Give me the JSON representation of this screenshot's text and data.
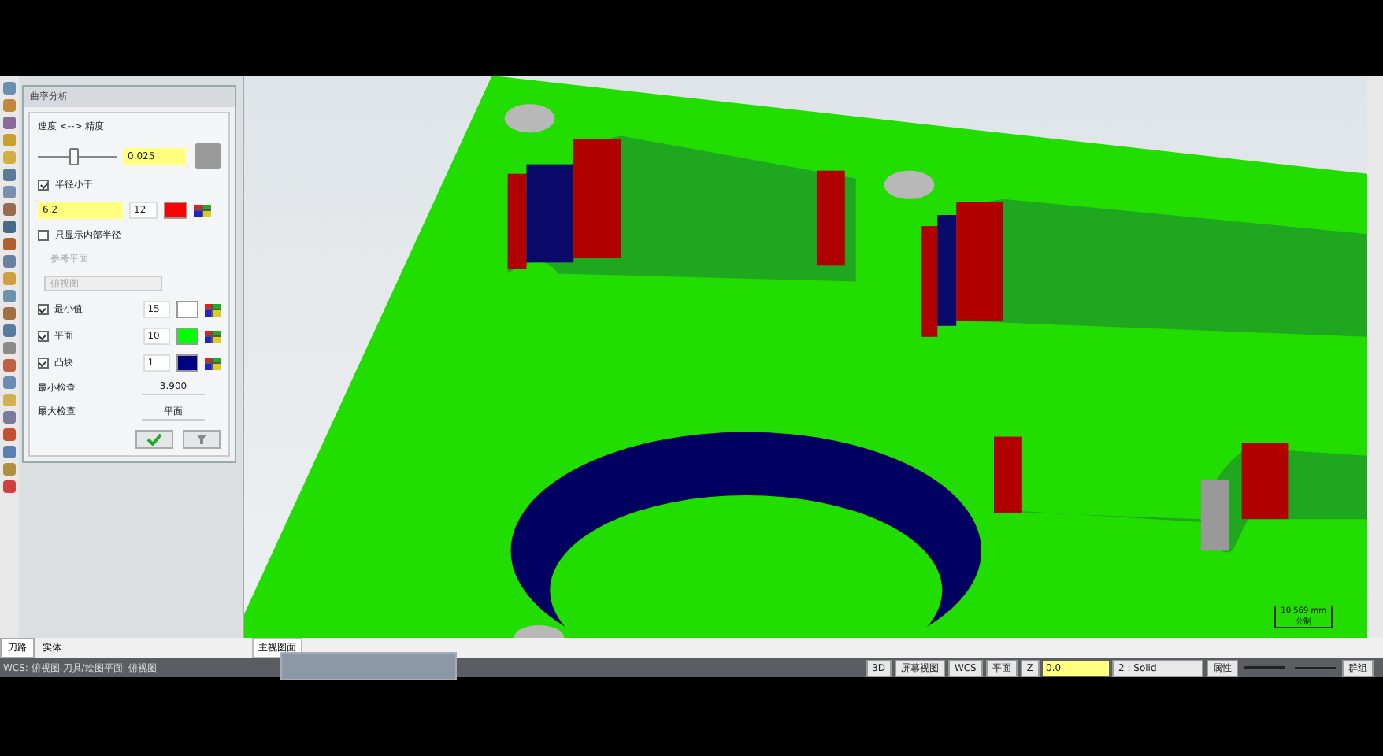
{
  "panel": {
    "title": "曲率分析",
    "slider_label": "速度 <--> 精度",
    "slider": {
      "level": 0.45
    },
    "tolerance": "0.025",
    "radius_option": {
      "label": "半径小于",
      "checked": true,
      "value": "6.2",
      "count": "12",
      "color": "#ff0000"
    },
    "internal_only": {
      "label": "只显示内部半径",
      "checked": false
    },
    "reference_plane": {
      "label": "参考平面",
      "value": "俯视图",
      "disabled": true
    },
    "rows": [
      {
        "label": "最小值",
        "checked": true,
        "count": "15",
        "color": "#ffffff"
      },
      {
        "label": "平面",
        "checked": true,
        "count": "10",
        "color": "#00ff00"
      },
      {
        "label": "凸块",
        "checked": true,
        "count": "1",
        "color": "#000080"
      }
    ],
    "readouts": [
      {
        "label": "最小检查",
        "value": "3.900"
      },
      {
        "label": "最大检查",
        "value": "平面"
      }
    ]
  },
  "manager_tabs": [
    {
      "label": "刀路",
      "selected": true
    },
    {
      "label": "实体",
      "selected": false
    }
  ],
  "viewport": {
    "tab": "主视图面",
    "scale": "10.569 mm",
    "units": "公制"
  },
  "status_bar": {
    "left": "WCS: 俯视图  刀具/绘图平面: 俯视图",
    "items": [
      "3D",
      "屏幕视图",
      "WCS",
      "平面"
    ],
    "z_label": "Z",
    "z_value": "0.0",
    "level": "2 : Solid",
    "attrs": "属性",
    "group": "群组"
  }
}
